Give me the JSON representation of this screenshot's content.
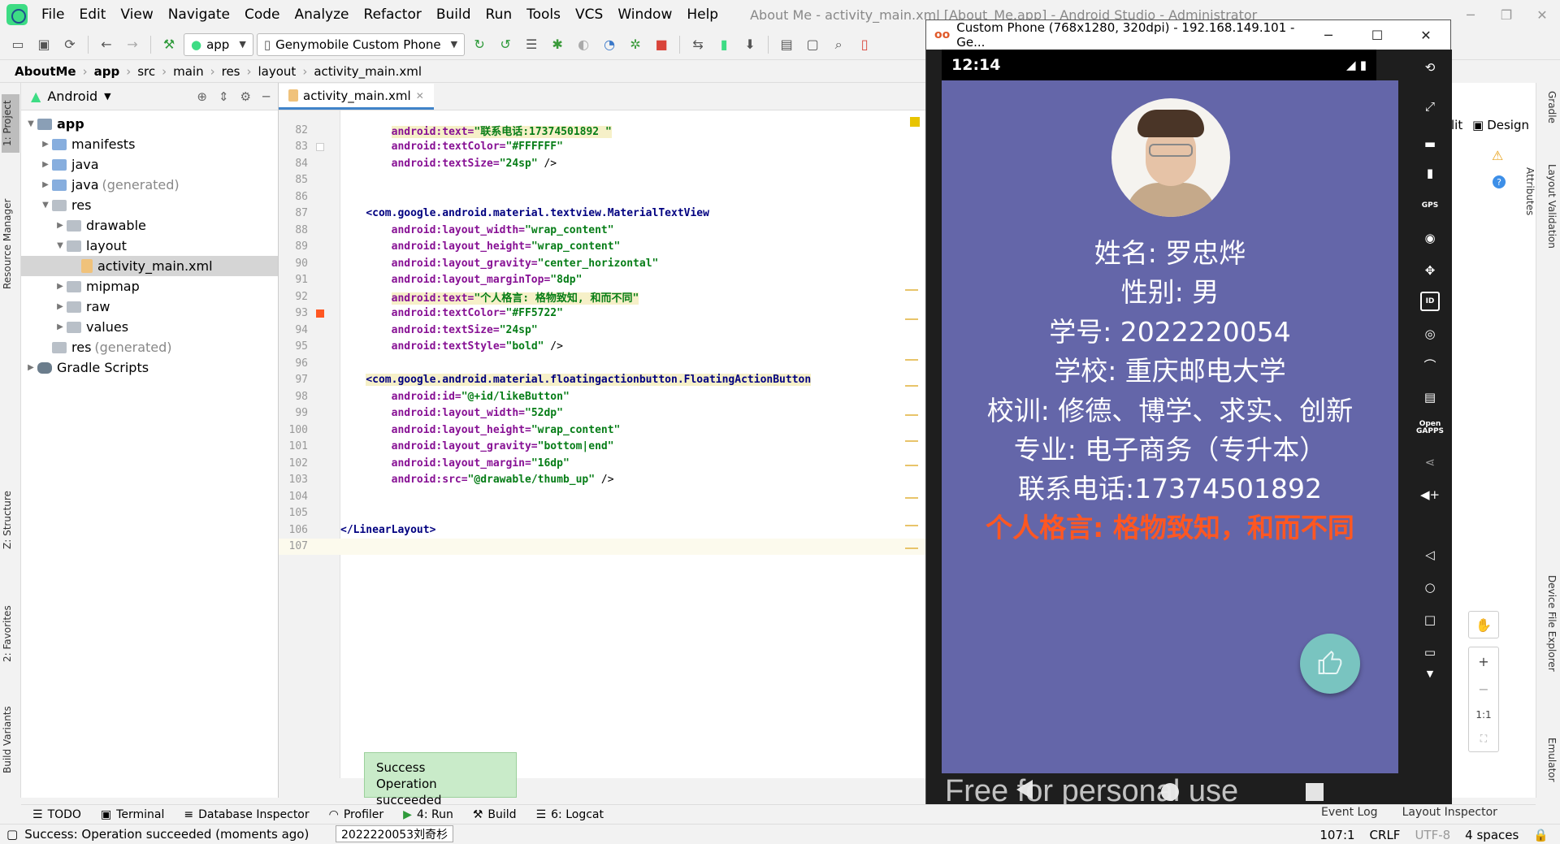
{
  "menubar": {
    "items": [
      "File",
      "Edit",
      "View",
      "Navigate",
      "Code",
      "Analyze",
      "Refactor",
      "Build",
      "Run",
      "Tools",
      "VCS",
      "Window",
      "Help"
    ],
    "window_title": "About Me - activity_main.xml [About_Me.app] - Android Studio - Administrator"
  },
  "toolbar": {
    "run_config": "app",
    "device": "Genymobile Custom Phone"
  },
  "breadcrumb": [
    "AboutMe",
    "app",
    "src",
    "main",
    "res",
    "layout",
    "activity_main.xml"
  ],
  "left_strip": {
    "tabs": [
      "1: Project",
      "Resource Manager",
      "Z: Structure",
      "2: Favorites",
      "Build Variants"
    ]
  },
  "right_strip": {
    "tabs": [
      "Gradle",
      "Layout Validation",
      "Device File Explorer",
      "Emulator"
    ],
    "attributes": "Attributes"
  },
  "project": {
    "view": "Android",
    "tree": [
      {
        "label": "app",
        "level": 0,
        "expanded": true,
        "type": "module",
        "bold": true
      },
      {
        "label": "manifests",
        "level": 1,
        "expanded": false,
        "type": "folder"
      },
      {
        "label": "java",
        "level": 1,
        "expanded": false,
        "type": "folder"
      },
      {
        "label": "java",
        "suffix": "(generated)",
        "level": 1,
        "expanded": false,
        "type": "folder"
      },
      {
        "label": "res",
        "level": 1,
        "expanded": true,
        "type": "res"
      },
      {
        "label": "drawable",
        "level": 2,
        "expanded": false,
        "type": "res"
      },
      {
        "label": "layout",
        "level": 2,
        "expanded": true,
        "type": "res"
      },
      {
        "label": "activity_main.xml",
        "level": 3,
        "type": "xml",
        "selected": true
      },
      {
        "label": "mipmap",
        "level": 2,
        "expanded": false,
        "type": "res"
      },
      {
        "label": "raw",
        "level": 2,
        "expanded": false,
        "type": "res"
      },
      {
        "label": "values",
        "level": 2,
        "expanded": false,
        "type": "res"
      },
      {
        "label": "res",
        "suffix": "(generated)",
        "level": 1,
        "type": "res"
      },
      {
        "label": "Gradle Scripts",
        "level": 0,
        "expanded": false,
        "type": "gradle"
      }
    ]
  },
  "editor": {
    "tab": "activity_main.xml",
    "lines": [
      {
        "n": "82",
        "indent": "        ",
        "attr": "android:text=",
        "val": "\"联系电话:17374501892 \"",
        "end": "",
        "hl": true
      },
      {
        "n": "83",
        "indent": "        ",
        "attr": "android:textColor=",
        "val": "\"#FFFFFF\"",
        "end": ""
      },
      {
        "n": "84",
        "indent": "        ",
        "attr": "android:textSize=",
        "val": "\"24sp\"",
        "end": " />"
      },
      {
        "n": "85",
        "text": ""
      },
      {
        "n": "86",
        "text": ""
      },
      {
        "n": "87",
        "indent": "    ",
        "tag": "<com.google.android.material.textview.MaterialTextView"
      },
      {
        "n": "88",
        "indent": "        ",
        "attr": "android:layout_width=",
        "val": "\"wrap_content\"",
        "end": ""
      },
      {
        "n": "89",
        "indent": "        ",
        "attr": "android:layout_height=",
        "val": "\"wrap_content\"",
        "end": ""
      },
      {
        "n": "90",
        "indent": "        ",
        "attr": "android:layout_gravity=",
        "val": "\"center_horizontal\"",
        "end": ""
      },
      {
        "n": "91",
        "indent": "        ",
        "attr": "android:layout_marginTop=",
        "val": "\"8dp\"",
        "end": ""
      },
      {
        "n": "92",
        "indent": "        ",
        "attr": "android:text=",
        "val": "\"个人格言: 格物致知, 和而不同\"",
        "end": "",
        "hl": true
      },
      {
        "n": "93",
        "indent": "        ",
        "attr": "android:textColor=",
        "val": "\"#FF5722\"",
        "end": ""
      },
      {
        "n": "94",
        "indent": "        ",
        "attr": "android:textSize=",
        "val": "\"24sp\"",
        "end": ""
      },
      {
        "n": "95",
        "indent": "        ",
        "attr": "android:textStyle=",
        "val": "\"bold\"",
        "end": " />"
      },
      {
        "n": "96",
        "text": ""
      },
      {
        "n": "97",
        "indent": "    ",
        "tag": "<com.google.android.material.floatingactionbutton.FloatingActionButton",
        "hl": true
      },
      {
        "n": "98",
        "indent": "        ",
        "attr": "android:id=",
        "val": "\"@+id/likeButton\"",
        "end": ""
      },
      {
        "n": "99",
        "indent": "        ",
        "attr": "android:layout_width=",
        "val": "\"52dp\"",
        "end": ""
      },
      {
        "n": "100",
        "indent": "        ",
        "attr": "android:layout_height=",
        "val": "\"wrap_content\"",
        "end": ""
      },
      {
        "n": "101",
        "indent": "        ",
        "attr": "android:layout_gravity=",
        "val": "\"bottom|end\"",
        "end": ""
      },
      {
        "n": "102",
        "indent": "        ",
        "attr": "android:layout_margin=",
        "val": "\"16dp\"",
        "end": ""
      },
      {
        "n": "103",
        "indent": "        ",
        "attr": "android:src=",
        "val": "\"@drawable/thumb_up\"",
        "end": " />"
      },
      {
        "n": "104",
        "text": ""
      },
      {
        "n": "105",
        "text": ""
      },
      {
        "n": "106",
        "indent": "",
        "tag": "</LinearLayout>"
      },
      {
        "n": "107",
        "text": "",
        "current": true
      }
    ]
  },
  "emulator": {
    "title": "Custom Phone (768x1280, 320dpi) - 192.168.149.101 - Ge...",
    "logo": "oo",
    "time": "12:14",
    "profile": {
      "name": "姓名: 罗忠烨",
      "gender": "性别: 男",
      "student_id": "学号: 2022220054",
      "school": "学校: 重庆邮电大学",
      "motto_school": "校训: 修德、博学、求实、创新",
      "major": "专业: 电子商务（专升本）",
      "phone": "联系电话:17374501892",
      "motto": "个人格言: 格物致知，和而不同"
    },
    "watermark": "Free for personal use",
    "side_labels": {
      "gps": "GPS",
      "id": "ID",
      "open_gapps": "Open GAPPS"
    }
  },
  "design": {
    "split": "lit",
    "design_label": "Design"
  },
  "bottom_tabs": [
    "TODO",
    "Terminal",
    "Database Inspector",
    "Profiler",
    "4: Run",
    "Build",
    "6: Logcat"
  ],
  "bottom_right_tabs": [
    "Event Log",
    "Layout Inspector"
  ],
  "balloon": {
    "title": "Success",
    "body": "Operation succeeded"
  },
  "status": {
    "message": "Success: Operation succeeded (moments ago)",
    "tooltip": "2022220053刘奇杉",
    "position": "107:1",
    "line_sep": "CRLF",
    "encoding": "UTF-8",
    "indent": "4 spaces"
  }
}
